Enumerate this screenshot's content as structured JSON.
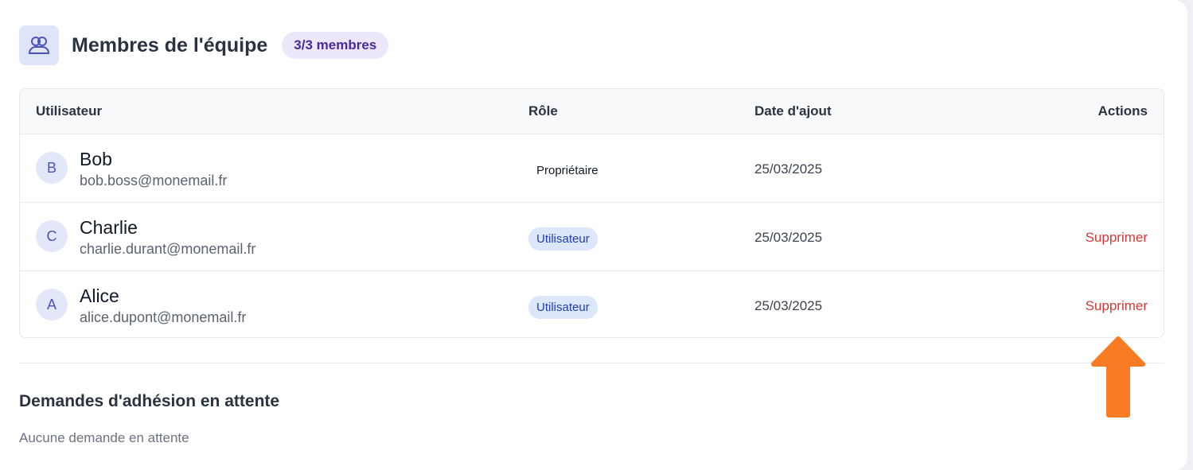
{
  "header": {
    "icon": "users-icon",
    "title": "Membres de l'équipe",
    "count_badge": "3/3 membres"
  },
  "table": {
    "columns": {
      "user": "Utilisateur",
      "role": "Rôle",
      "date": "Date d'ajout",
      "actions": "Actions"
    },
    "rows": [
      {
        "initial": "B",
        "name": "Bob",
        "email": "bob.boss@monemail.fr",
        "role": "Propriétaire",
        "date": "25/03/2025",
        "action": ""
      },
      {
        "initial": "C",
        "name": "Charlie",
        "email": "charlie.durant@monemail.fr",
        "role": "Utilisateur",
        "date": "25/03/2025",
        "action": "Supprimer"
      },
      {
        "initial": "A",
        "name": "Alice",
        "email": "alice.dupont@monemail.fr",
        "role": "Utilisateur",
        "date": "25/03/2025",
        "action": "Supprimer"
      }
    ]
  },
  "pending": {
    "title": "Demandes d'adhésion en attente",
    "empty_text": "Aucune demande en attente"
  },
  "colors": {
    "accent": "#4b53b8",
    "danger": "#d23a3a",
    "arrow": "#f97c24"
  }
}
